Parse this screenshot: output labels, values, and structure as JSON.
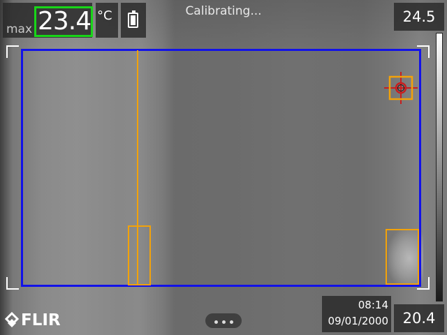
{
  "measurement": {
    "label": "max",
    "value": "23.4",
    "unit": "°C",
    "highlight_color": "#18d618"
  },
  "battery": {
    "icon": "battery-icon",
    "level": 0.8
  },
  "status_text": "Calibrating...",
  "scale": {
    "max": "24.5",
    "min": "20.4",
    "palette": "iron-grey"
  },
  "overlay": {
    "area_box_color": "#1212e8",
    "marker_color": "#f2a20a",
    "spot_icon": "crosshair-spot-icon"
  },
  "clock": {
    "time": "08:14",
    "date": "09/01/2000"
  },
  "brand": {
    "text": "FLIR",
    "icon": "flir-logo-icon"
  },
  "more_menu": {
    "icon": "more-dots-icon"
  }
}
